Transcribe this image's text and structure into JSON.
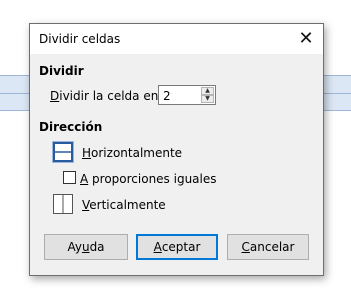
{
  "dialog": {
    "title": "Dividir celdas",
    "close_icon": "close-icon"
  },
  "divide": {
    "heading": "Dividir",
    "split_label_u": "D",
    "split_label_rest": "ividir la celda en:",
    "split_value": "2"
  },
  "direction": {
    "heading": "Dirección",
    "horizontal_u": "H",
    "horizontal_rest": "orizontalmente",
    "equal_u": "A",
    "equal_rest": " proporciones iguales",
    "vertical_u": "V",
    "vertical_rest": "erticalmente"
  },
  "buttons": {
    "help_pre": "Ay",
    "help_u": "u",
    "help_post": "da",
    "ok_u": "A",
    "ok_rest": "ceptar",
    "cancel_u": "C",
    "cancel_rest": "ancelar"
  },
  "colors": {
    "accent": "#0078d7",
    "selected_icon": "#2a5b9c",
    "background_strip": "#dbe7f5"
  }
}
